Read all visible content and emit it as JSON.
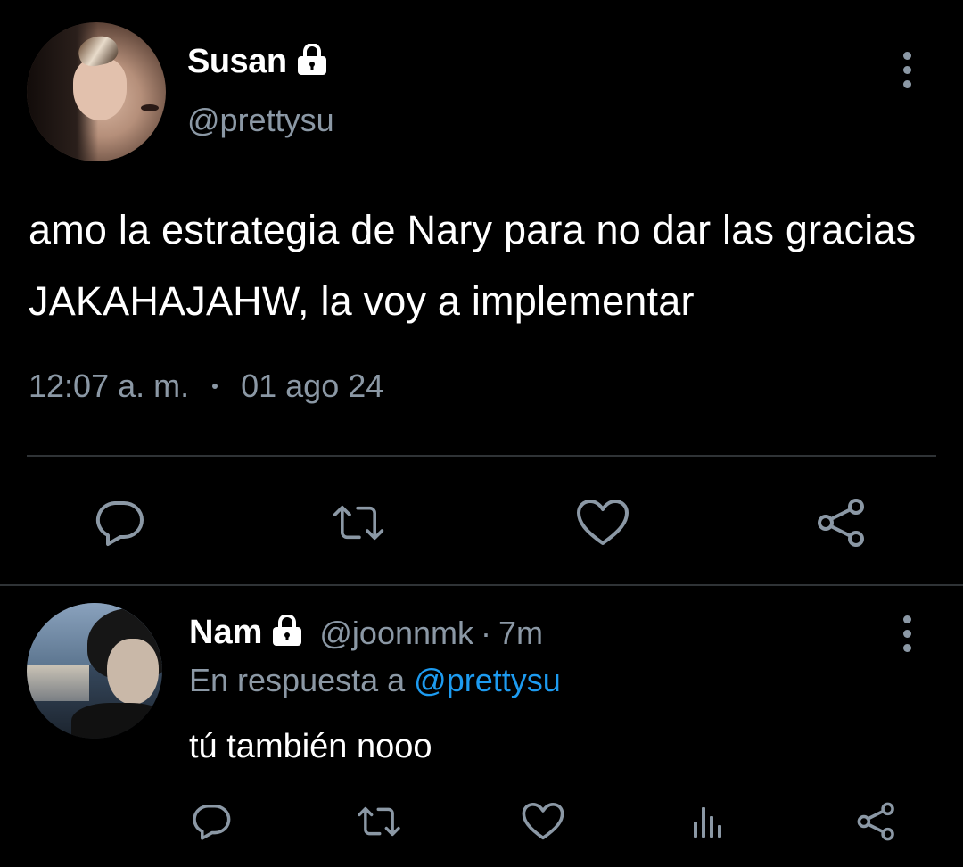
{
  "theme": {
    "background": "#000000",
    "text_primary": "#ffffff",
    "text_secondary": "#8b98a5",
    "link": "#1d9bf0",
    "divider": "#2f3336"
  },
  "main_tweet": {
    "author_name": "Susan",
    "author_handle": "@prettysu",
    "text": "amo la estrategia de Nary para no dar las gracias JAKAHAJAHW, la voy a implementar",
    "time": "12:07 a. m.",
    "date": "01 ago 24",
    "actions": [
      "reply-icon",
      "retweet-icon",
      "like-icon",
      "share-icon"
    ]
  },
  "reply_tweet": {
    "author_name": "Nam",
    "author_handle": "@joonnmk",
    "separator": "·",
    "time_ago": "7m",
    "replying_to_prefix": "En respuesta a",
    "replying_to_handle": "@prettysu",
    "text": "tú también nooo",
    "actions": [
      "reply-icon",
      "retweet-icon",
      "like-icon",
      "analytics-icon",
      "share-icon"
    ]
  }
}
